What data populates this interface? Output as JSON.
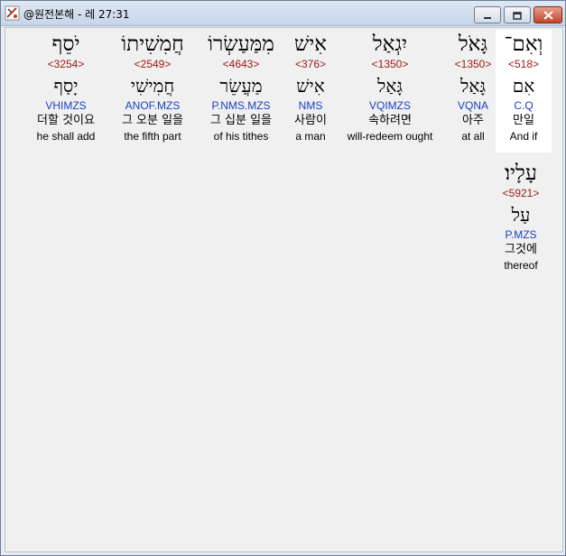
{
  "window": {
    "title": "@원전본해 - 레 27:31",
    "controls": {
      "minimize": "minimize-icon",
      "maximize": "maximize-icon",
      "close": "close-icon"
    }
  },
  "words": [
    {
      "hebrew": "וְאִם־",
      "strong": "<518>",
      "lemma": "אִם",
      "parse": "C.Q",
      "korean": "만일",
      "english": "And if"
    },
    {
      "hebrew": "גָּאֹל",
      "strong": "<1350>",
      "lemma": "גָּאַל",
      "parse": "VQNA",
      "korean": "아주",
      "english": "at all"
    },
    {
      "hebrew": "יִגְאַל",
      "strong": "<1350>",
      "lemma": "גָּאַל",
      "parse": "VQIMZS",
      "korean": "속하려면",
      "english": "will-redeem ought"
    },
    {
      "hebrew": "אִישׁ",
      "strong": "<376>",
      "lemma": "אִישׁ",
      "parse": "NMS",
      "korean": "사람이",
      "english": "a man"
    },
    {
      "hebrew": "מִמַּעַשְׂרוֹ",
      "strong": "<4643>",
      "lemma": "מַעֲשֵׂר",
      "parse": "P.NMS.MZS",
      "korean": "그 십분 일을",
      "english": "of his tithes"
    },
    {
      "hebrew": "חֲמִשִׁיתוֹ",
      "strong": "<2549>",
      "lemma": "חֲמִישִׁי",
      "parse": "ANOF.MZS",
      "korean": "그 오분 일을",
      "english": "the fifth part"
    },
    {
      "hebrew": "יֹסֵף",
      "strong": "<3254>",
      "lemma": "יָסַף",
      "parse": "VHIMZS",
      "korean": "더할 것이요",
      "english": "he shall add"
    },
    {
      "hebrew": "עָלָיו׃",
      "strong": "<5921>",
      "lemma": "עַל",
      "parse": "P.MZS",
      "korean": "그것에",
      "english": "thereof"
    }
  ]
}
